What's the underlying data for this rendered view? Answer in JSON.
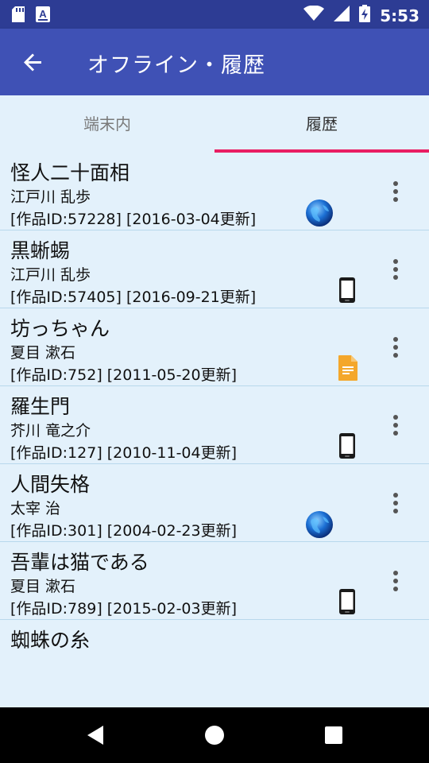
{
  "status_bar": {
    "time": "5:53",
    "icons": [
      "sd-card-icon",
      "keyboard-a-icon",
      "wifi-icon",
      "signal-icon",
      "battery-charging-icon"
    ]
  },
  "app_bar": {
    "title": "オフライン・履歴",
    "back_icon": "arrow-left-icon"
  },
  "tabs": [
    {
      "label": "端末内",
      "selected": false
    },
    {
      "label": "履歴",
      "selected": true
    }
  ],
  "colors": {
    "app_bar": "#3f51b5",
    "status_bar": "#2d3c94",
    "tab_indicator": "#e91e63",
    "list_bg": "#e3f1fb"
  },
  "history": [
    {
      "title": "怪人二十面相",
      "author": "江戸川 乱歩",
      "meta": "[作品ID:57228] [2016-03-04更新]",
      "source_icon": "globe-icon"
    },
    {
      "title": "黒蜥蜴",
      "author": "江戸川 乱歩",
      "meta": "[作品ID:57405] [2016-09-21更新]",
      "source_icon": "phone-icon"
    },
    {
      "title": "坊っちゃん",
      "author": "夏目 漱石",
      "meta": "[作品ID:752] [2011-05-20更新]",
      "source_icon": "document-icon"
    },
    {
      "title": "羅生門",
      "author": "芥川 竜之介",
      "meta": "[作品ID:127] [2010-11-04更新]",
      "source_icon": "phone-icon"
    },
    {
      "title": "人間失格",
      "author": "太宰 治",
      "meta": "[作品ID:301] [2004-02-23更新]",
      "source_icon": "globe-icon"
    },
    {
      "title": "吾輩は猫である",
      "author": "夏目 漱石",
      "meta": "[作品ID:789] [2015-02-03更新]",
      "source_icon": "phone-icon"
    },
    {
      "title": "蜘蛛の糸",
      "author": "",
      "meta": "",
      "source_icon": ""
    }
  ],
  "nav_bar": {
    "icons": [
      "back-triangle-icon",
      "home-circle-icon",
      "recents-square-icon"
    ]
  }
}
